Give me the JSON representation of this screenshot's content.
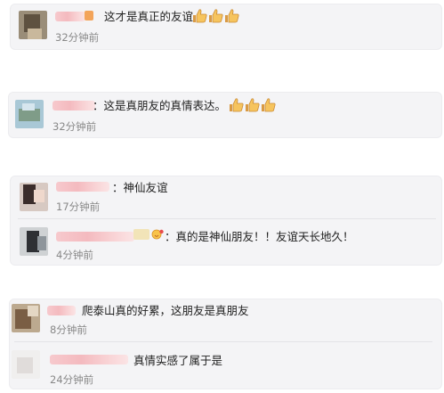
{
  "icons": {
    "thumbs_up": "thumbs-up-icon",
    "emoji": "emoji-icon"
  },
  "colors": {
    "card_bg": "#f4f4f6",
    "name_blur": "#f4b7bc",
    "time": "#888888",
    "text": "#222222"
  },
  "comments": [
    {
      "text": "这才是真正的友谊",
      "time": "32分钟前"
    },
    {
      "text": "：这是真朋友的真情表达。",
      "time": "32分钟前"
    },
    {
      "text": "：神仙友谊",
      "time": "17分钟前"
    },
    {
      "text": "：真的是神仙朋友！！友谊天长地久！",
      "time": "4分钟前"
    },
    {
      "text": "爬泰山真的好累，这朋友是真朋友",
      "time": "8分钟前"
    },
    {
      "text": "真情实感了属于是",
      "time": "24分钟前"
    }
  ]
}
